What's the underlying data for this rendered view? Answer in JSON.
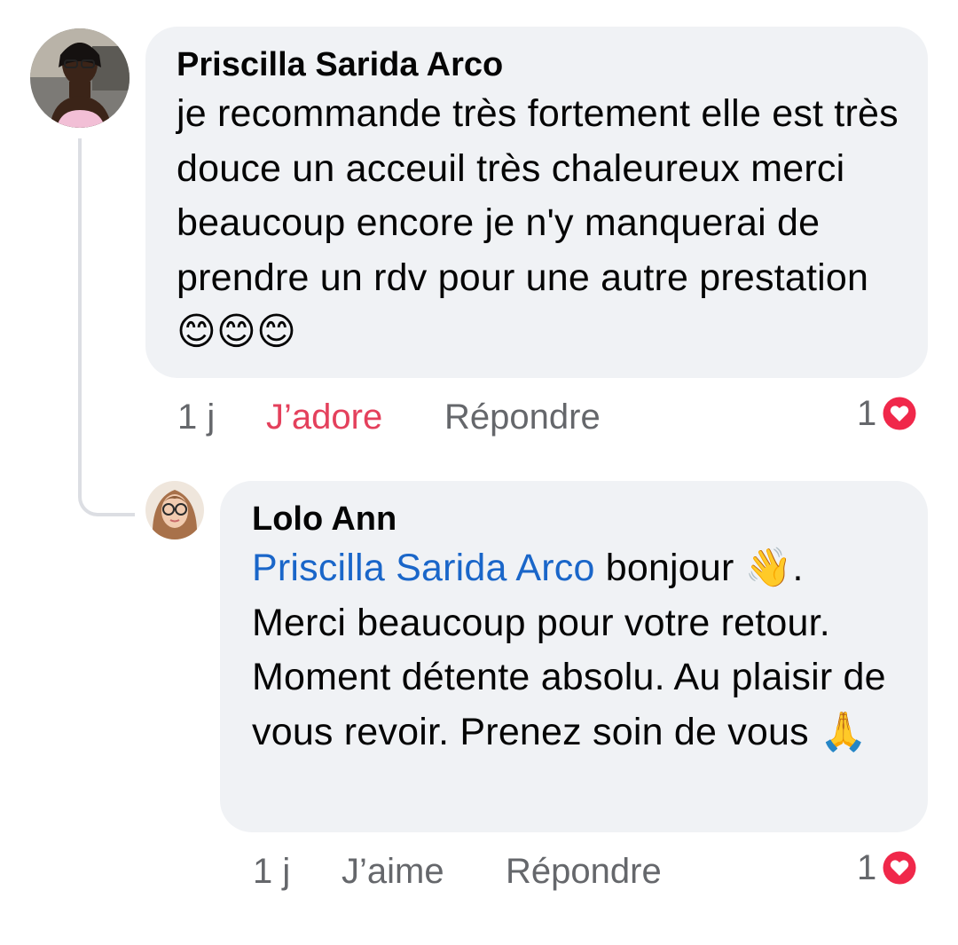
{
  "comments": [
    {
      "author": "Priscilla Sarida Arco",
      "avatar_icon": "avatar-photo",
      "text": "je recommande très fortement elle est très douce un acceuil très chaleureux merci beaucoup encore je n'y manquerai de prendre un rdv pour une autre prestation",
      "emojis": [
        "😊",
        "😊",
        "😊"
      ],
      "time": "1 j",
      "reaction_label": "J’adore",
      "reply_label": "Répondre",
      "reaction_count": "1",
      "reaction_icon": "heart-icon"
    },
    {
      "author": "Lolo Ann",
      "avatar_icon": "avatar-photo",
      "mention": "Priscilla Sarida Arco",
      "text_before_wave": " bonjour ",
      "wave_emoji": "👋",
      "text_after_wave": ". Merci beaucoup pour votre retour. Moment détente absolu. Au plaisir de vous revoir.  Prenez soin de vous ",
      "pray_emoji": "🙏",
      "time": "1 j",
      "reaction_label": "J’aime",
      "reply_label": "Répondre",
      "reaction_count": "1",
      "reaction_icon": "heart-icon"
    }
  ],
  "colors": {
    "bubble": "#f0f2f5",
    "mention": "#1a66c9",
    "loved": "#e4405c",
    "meta": "#65676b"
  }
}
